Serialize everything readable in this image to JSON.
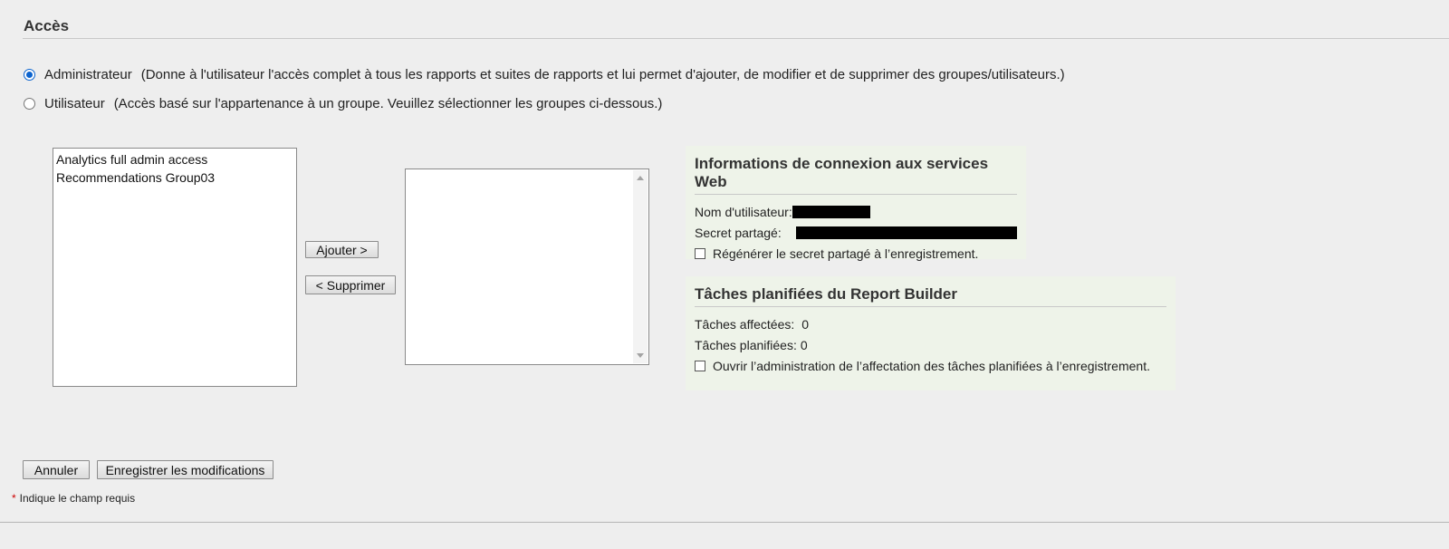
{
  "access": {
    "title": "Accès",
    "admin_label": "Administrateur",
    "admin_desc": "(Donne à l'utilisateur l'accès complet à tous les rapports et suites de rapports et lui permet d'ajouter, de modifier et de supprimer des groupes/utilisateurs.)",
    "user_label": "Utilisateur",
    "user_desc": "(Accès basé sur l'appartenance à un groupe. Veuillez sélectionner les groupes ci-dessous.)",
    "selected": "Administrateur"
  },
  "groups": {
    "available": [
      "Analytics full admin access",
      "Recommendations Group03"
    ],
    "selected": [],
    "add_button": "Ajouter >",
    "remove_button": "< Supprimer"
  },
  "web_services": {
    "title": "Informations de connexion aux services Web",
    "username_label": "Nom d'utilisateur:",
    "secret_label": "Secret partagé:",
    "regenerate_label": "Régénérer le secret partagé à l’enregistrement.",
    "regenerate_checked": false
  },
  "report_builder": {
    "title": "Tâches planifiées du Report Builder",
    "assigned_label": "Tâches affectées:",
    "assigned_value": "0",
    "scheduled_label": "Tâches planifiées:",
    "scheduled_value": "0",
    "open_admin_label": "Ouvrir l’administration de l’affectation des tâches planifiées à l’enregistrement.",
    "open_admin_checked": false
  },
  "footer": {
    "cancel_button": "Annuler",
    "save_button": "Enregistrer les modifications",
    "required_star": "*",
    "required_note": "Indique le champ requis"
  },
  "colors": {
    "background": "#eeeeee",
    "panel": "#eef3e9",
    "radio_accent": "#0b63ce",
    "required": "#cc0000",
    "redaction": "#000000"
  }
}
